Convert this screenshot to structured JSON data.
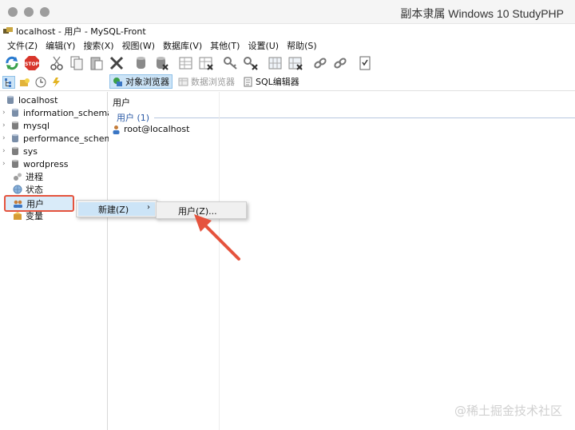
{
  "mac": {
    "title": "副本隶属 Windows 10 StudyPHP"
  },
  "window": {
    "title": "localhost - 用户 - MySQL-Front"
  },
  "menubar": [
    "文件(Z)",
    "编辑(Y)",
    "搜索(X)",
    "视图(W)",
    "数据库(V)",
    "其他(T)",
    "设置(U)",
    "帮助(S)"
  ],
  "toolbar": {
    "icons": [
      "refresh-icon",
      "stop-icon",
      "cut-icon",
      "copy-icon",
      "paste-icon",
      "delete-icon",
      "database-icon",
      "database-delete-icon",
      "table-icon",
      "table-delete-icon",
      "key-icon",
      "key-delete-icon",
      "grid-icon",
      "grid-delete-icon",
      "link-icon",
      "link-delete-icon",
      "checklist-icon"
    ],
    "stop_label": "STOP"
  },
  "view_tabs": [
    {
      "label": "对象浏览器",
      "active": true
    },
    {
      "label": "数据浏览器",
      "active": false
    },
    {
      "label": "SQL编辑器",
      "active": false
    }
  ],
  "tree": {
    "root": "localhost",
    "databases": [
      "information_schema",
      "mysql",
      "performance_schema",
      "sys",
      "wordpress"
    ],
    "extras": [
      "进程",
      "状态",
      "用户",
      "变量"
    ]
  },
  "right_panel": {
    "header": "用户",
    "group_label": "用户 (1)",
    "items": [
      "root@localhost"
    ]
  },
  "context_menu": {
    "item": "新建(Z)",
    "submenu_item": "用户(Z)..."
  },
  "watermark": "@稀土掘金技术社区",
  "colors": {
    "highlight": "#cce4f7",
    "annotation": "#e5533d",
    "group": "#2b5aa6"
  }
}
